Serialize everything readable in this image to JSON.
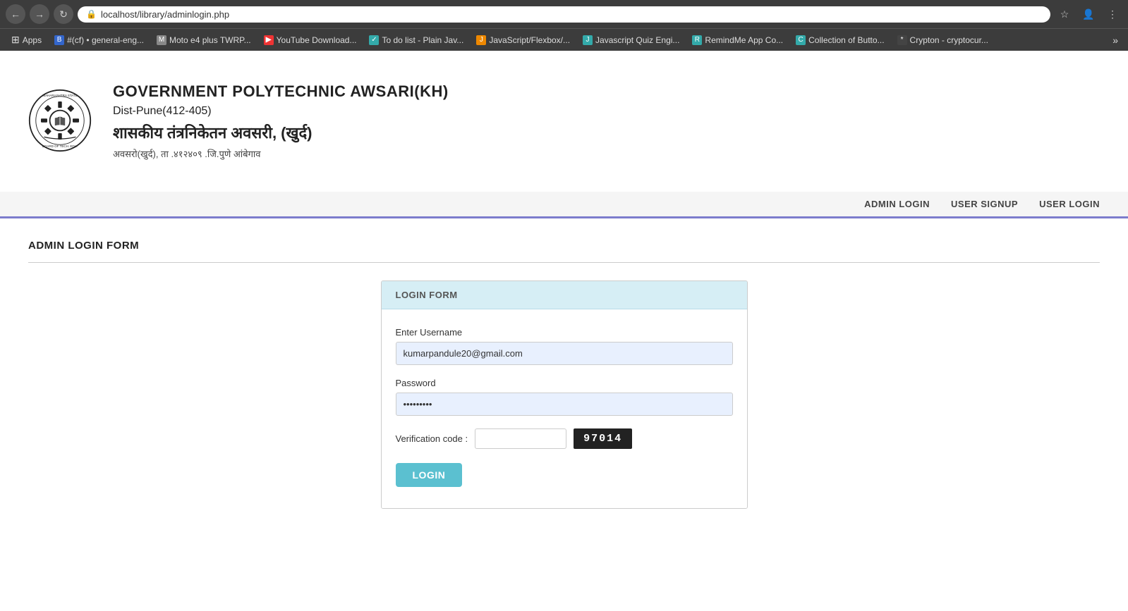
{
  "browser": {
    "url": "localhost/library/adminlogin.php",
    "back_label": "←",
    "forward_label": "→",
    "refresh_label": "↻",
    "menu_label": "⋮",
    "star_label": "☆",
    "profile_label": "👤"
  },
  "bookmarks": {
    "apps_label": "Apps",
    "items": [
      {
        "label": "#(cf) • general-eng...",
        "icon": "B",
        "color": "blue"
      },
      {
        "label": "Moto e4 plus TWRP...",
        "icon": "M",
        "color": "gray"
      },
      {
        "label": "YouTube Download...",
        "icon": "Y",
        "color": "red"
      },
      {
        "label": "To do list - Plain Jav...",
        "icon": "T",
        "color": "teal"
      },
      {
        "label": "JavaScript/Flexbox/...",
        "icon": "J",
        "color": "orange"
      },
      {
        "label": "Javascript Quiz Engi...",
        "icon": "J",
        "color": "teal"
      },
      {
        "label": "RemindMe App Co...",
        "icon": "R",
        "color": "teal"
      },
      {
        "label": "Collection of Butto...",
        "icon": "C",
        "color": "teal"
      },
      {
        "label": "Crypton - cryptocur...",
        "icon": "*",
        "color": "dark"
      }
    ]
  },
  "header": {
    "title_en": "GOVERNMENT POLYTECHNIC AWSARI(KH)",
    "dist": "Dist-Pune(412-405)",
    "title_hi": "शासकीय तंत्रनिकेतन अवसरी, (खुर्द)",
    "subtitle_hi": "अवसरो(खुर्द), ता .४१२४०९ .जि.पुणे आंबेगाव"
  },
  "nav": {
    "admin_login": "ADMIN LOGIN",
    "user_signup": "USER SIGNUP",
    "user_login": "USER LOGIN"
  },
  "page": {
    "section_title": "ADMIN LOGIN FORM",
    "form": {
      "card_header": "LOGIN FORM",
      "username_label": "Enter Username",
      "username_value": "kumarpandule20@gmail.com",
      "password_label": "Password",
      "password_value": "••••••••",
      "verification_label": "Verification code :",
      "verification_placeholder": "",
      "captcha_value": "97014",
      "login_button": "LOGIN"
    }
  }
}
